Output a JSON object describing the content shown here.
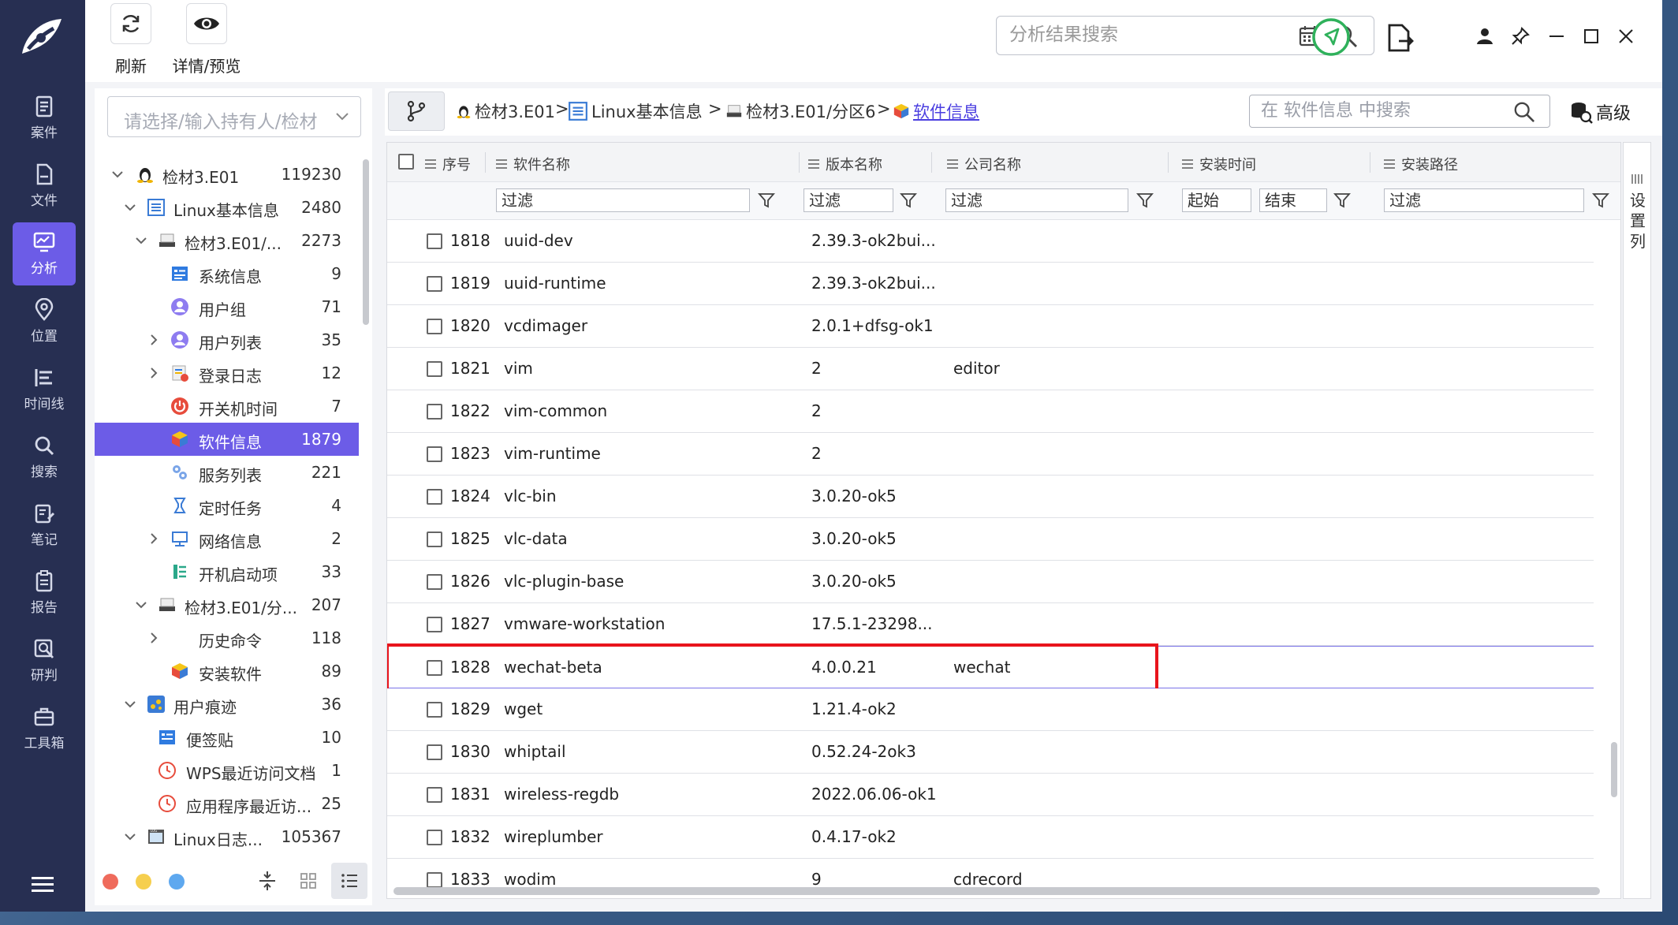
{
  "toolbar": {
    "refresh_label": "刷新",
    "detail_label": "详情/预览",
    "search_placeholder": "分析结果搜索"
  },
  "nav": {
    "items": [
      {
        "label": "案件",
        "icon": "case-icon"
      },
      {
        "label": "文件",
        "icon": "file-icon"
      },
      {
        "label": "分析",
        "icon": "analysis-icon",
        "active": true
      },
      {
        "label": "位置",
        "icon": "location-icon"
      },
      {
        "label": "时间线",
        "icon": "timeline-icon"
      },
      {
        "label": "搜索",
        "icon": "search-icon"
      },
      {
        "label": "笔记",
        "icon": "note-icon"
      },
      {
        "label": "报告",
        "icon": "report-icon"
      },
      {
        "label": "研判",
        "icon": "judge-icon"
      },
      {
        "label": "工具箱",
        "icon": "toolbox-icon"
      }
    ]
  },
  "tree": {
    "owner_placeholder": "请选择/输入持有人/检材",
    "items": [
      {
        "label": "检材3.E01",
        "count": "119230"
      },
      {
        "label": "Linux基本信息",
        "count": "2480"
      },
      {
        "label": "检材3.E01/...",
        "count": "2273"
      },
      {
        "label": "系统信息",
        "count": "9"
      },
      {
        "label": "用户组",
        "count": "71"
      },
      {
        "label": "用户列表",
        "count": "35"
      },
      {
        "label": "登录日志",
        "count": "12"
      },
      {
        "label": "开关机时间",
        "count": "7"
      },
      {
        "label": "软件信息",
        "count": "1879"
      },
      {
        "label": "服务列表",
        "count": "221"
      },
      {
        "label": "定时任务",
        "count": "4"
      },
      {
        "label": "网络信息",
        "count": "2"
      },
      {
        "label": "开机启动项",
        "count": "33"
      },
      {
        "label": "检材3.E01/分...",
        "count": "207"
      },
      {
        "label": "历史命令",
        "count": "118"
      },
      {
        "label": "安装软件",
        "count": "89"
      },
      {
        "label": "用户痕迹",
        "count": "36"
      },
      {
        "label": "便签贴",
        "count": "10"
      },
      {
        "label": "WPS最近访问文档",
        "count": "1"
      },
      {
        "label": "应用程序最近访...",
        "count": "25"
      },
      {
        "label": "Linux日志...",
        "count": "105367"
      }
    ]
  },
  "breadcrumb": {
    "items": [
      "检材3.E01",
      "Linux基本信息",
      "检材3.E01/分区6"
    ],
    "current": "软件信息",
    "sep": ">"
  },
  "main": {
    "search_placeholder": "在 软件信息 中搜索",
    "advanced_label": "高级",
    "column_setting_label": "设置列"
  },
  "table": {
    "columns": [
      "序号",
      "软件名称",
      "版本名称",
      "公司名称",
      "安装时间",
      "安装路径"
    ],
    "filters": {
      "text": "过滤",
      "start": "起始",
      "end": "结束"
    },
    "rows": [
      {
        "id": "1818",
        "name": "uuid-dev",
        "version": "2.39.3-ok2bui...",
        "company": ""
      },
      {
        "id": "1819",
        "name": "uuid-runtime",
        "version": "2.39.3-ok2bui...",
        "company": ""
      },
      {
        "id": "1820",
        "name": "vcdimager",
        "version": "2.0.1+dfsg-ok1",
        "company": ""
      },
      {
        "id": "1821",
        "name": "vim",
        "version": "2",
        "company": "editor"
      },
      {
        "id": "1822",
        "name": "vim-common",
        "version": "2",
        "company": ""
      },
      {
        "id": "1823",
        "name": "vim-runtime",
        "version": "2",
        "company": ""
      },
      {
        "id": "1824",
        "name": "vlc-bin",
        "version": "3.0.20-ok5",
        "company": ""
      },
      {
        "id": "1825",
        "name": "vlc-data",
        "version": "3.0.20-ok5",
        "company": ""
      },
      {
        "id": "1826",
        "name": "vlc-plugin-base",
        "version": "3.0.20-ok5",
        "company": ""
      },
      {
        "id": "1827",
        "name": "vmware-workstation",
        "version": "17.5.1-23298...",
        "company": ""
      },
      {
        "id": "1828",
        "name": "wechat-beta",
        "version": "4.0.0.21",
        "company": "wechat",
        "highlight": true
      },
      {
        "id": "1829",
        "name": "wget",
        "version": "1.21.4-ok2",
        "company": ""
      },
      {
        "id": "1830",
        "name": "whiptail",
        "version": "0.52.24-2ok3",
        "company": ""
      },
      {
        "id": "1831",
        "name": "wireless-regdb",
        "version": "2022.06.06-ok1",
        "company": ""
      },
      {
        "id": "1832",
        "name": "wireplumber",
        "version": "0.4.17-ok2",
        "company": ""
      },
      {
        "id": "1833",
        "name": "wodim",
        "version": "9",
        "company": "cdrecord"
      }
    ]
  },
  "colors": {
    "nav_bg": "#272f52",
    "accent": "#6c5ce7",
    "highlight_box": "#e8141c"
  }
}
